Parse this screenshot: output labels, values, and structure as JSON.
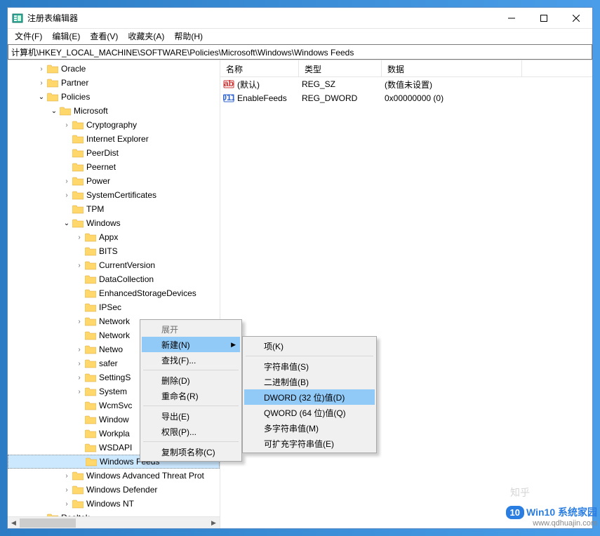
{
  "window": {
    "title": "注册表编辑器"
  },
  "menubar": [
    "文件(F)",
    "编辑(E)",
    "查看(V)",
    "收藏夹(A)",
    "帮助(H)"
  ],
  "address": "计算机\\HKEY_LOCAL_MACHINE\\SOFTWARE\\Policies\\Microsoft\\Windows\\Windows Feeds",
  "tree": [
    {
      "lvl": 2,
      "exp": ">",
      "label": "Oracle"
    },
    {
      "lvl": 2,
      "exp": ">",
      "label": "Partner"
    },
    {
      "lvl": 2,
      "exp": "v",
      "label": "Policies"
    },
    {
      "lvl": 3,
      "exp": "v",
      "label": "Microsoft"
    },
    {
      "lvl": 4,
      "exp": ">",
      "label": "Cryptography"
    },
    {
      "lvl": 4,
      "exp": "",
      "label": "Internet Explorer"
    },
    {
      "lvl": 4,
      "exp": "",
      "label": "PeerDist"
    },
    {
      "lvl": 4,
      "exp": "",
      "label": "Peernet"
    },
    {
      "lvl": 4,
      "exp": ">",
      "label": "Power"
    },
    {
      "lvl": 4,
      "exp": ">",
      "label": "SystemCertificates"
    },
    {
      "lvl": 4,
      "exp": "",
      "label": "TPM"
    },
    {
      "lvl": 4,
      "exp": "v",
      "label": "Windows"
    },
    {
      "lvl": 5,
      "exp": ">",
      "label": "Appx"
    },
    {
      "lvl": 5,
      "exp": "",
      "label": "BITS"
    },
    {
      "lvl": 5,
      "exp": ">",
      "label": "CurrentVersion"
    },
    {
      "lvl": 5,
      "exp": "",
      "label": "DataCollection"
    },
    {
      "lvl": 5,
      "exp": "",
      "label": "EnhancedStorageDevices"
    },
    {
      "lvl": 5,
      "exp": "",
      "label": "IPSec"
    },
    {
      "lvl": 5,
      "exp": ">",
      "label": "Network"
    },
    {
      "lvl": 5,
      "exp": "",
      "label": "Network"
    },
    {
      "lvl": 5,
      "exp": ">",
      "label": "Netwo"
    },
    {
      "lvl": 5,
      "exp": ">",
      "label": "safer"
    },
    {
      "lvl": 5,
      "exp": ">",
      "label": "SettingS"
    },
    {
      "lvl": 5,
      "exp": ">",
      "label": "System"
    },
    {
      "lvl": 5,
      "exp": "",
      "label": "WcmSvc"
    },
    {
      "lvl": 5,
      "exp": "",
      "label": "Window"
    },
    {
      "lvl": 5,
      "exp": "",
      "label": "Workpla"
    },
    {
      "lvl": 5,
      "exp": "",
      "label": "WSDAPI"
    },
    {
      "lvl": 5,
      "exp": "",
      "label": "Windows Feeds",
      "sel": true
    },
    {
      "lvl": 4,
      "exp": ">",
      "label": "Windows Advanced Threat Prot"
    },
    {
      "lvl": 4,
      "exp": ">",
      "label": "Windows Defender"
    },
    {
      "lvl": 4,
      "exp": ">",
      "label": "Windows NT"
    },
    {
      "lvl": 2,
      "exp": ">",
      "label": "Realtek"
    }
  ],
  "list": {
    "headers": [
      "名称",
      "类型",
      "数据"
    ],
    "widths": [
      112,
      118,
      200
    ],
    "rows": [
      {
        "icon": "str",
        "name": "(默认)",
        "type": "REG_SZ",
        "data": "(数值未设置)"
      },
      {
        "icon": "bin",
        "name": "EnableFeeds",
        "type": "REG_DWORD",
        "data": "0x00000000 (0)"
      }
    ]
  },
  "ctx1": {
    "items": [
      {
        "label": "展开",
        "disabled": true
      },
      {
        "label": "新建(N)",
        "hl": true,
        "submenu": true
      },
      {
        "label": "查找(F)..."
      },
      {
        "sep": true
      },
      {
        "label": "删除(D)"
      },
      {
        "label": "重命名(R)"
      },
      {
        "sep": true
      },
      {
        "label": "导出(E)"
      },
      {
        "label": "权限(P)..."
      },
      {
        "sep": true
      },
      {
        "label": "复制项名称(C)"
      }
    ]
  },
  "ctx2": {
    "items": [
      {
        "label": "项(K)"
      },
      {
        "sep": true
      },
      {
        "label": "字符串值(S)"
      },
      {
        "label": "二进制值(B)"
      },
      {
        "label": "DWORD (32 位)值(D)",
        "hl": true
      },
      {
        "label": "QWORD (64 位)值(Q)"
      },
      {
        "label": "多字符串值(M)"
      },
      {
        "label": "可扩充字符串值(E)"
      }
    ]
  },
  "watermark": {
    "zhihu": "知乎",
    "brand_prefix": "10",
    "brand_text": "Win10 系统家园",
    "url": "www.qdhuajin.com"
  }
}
